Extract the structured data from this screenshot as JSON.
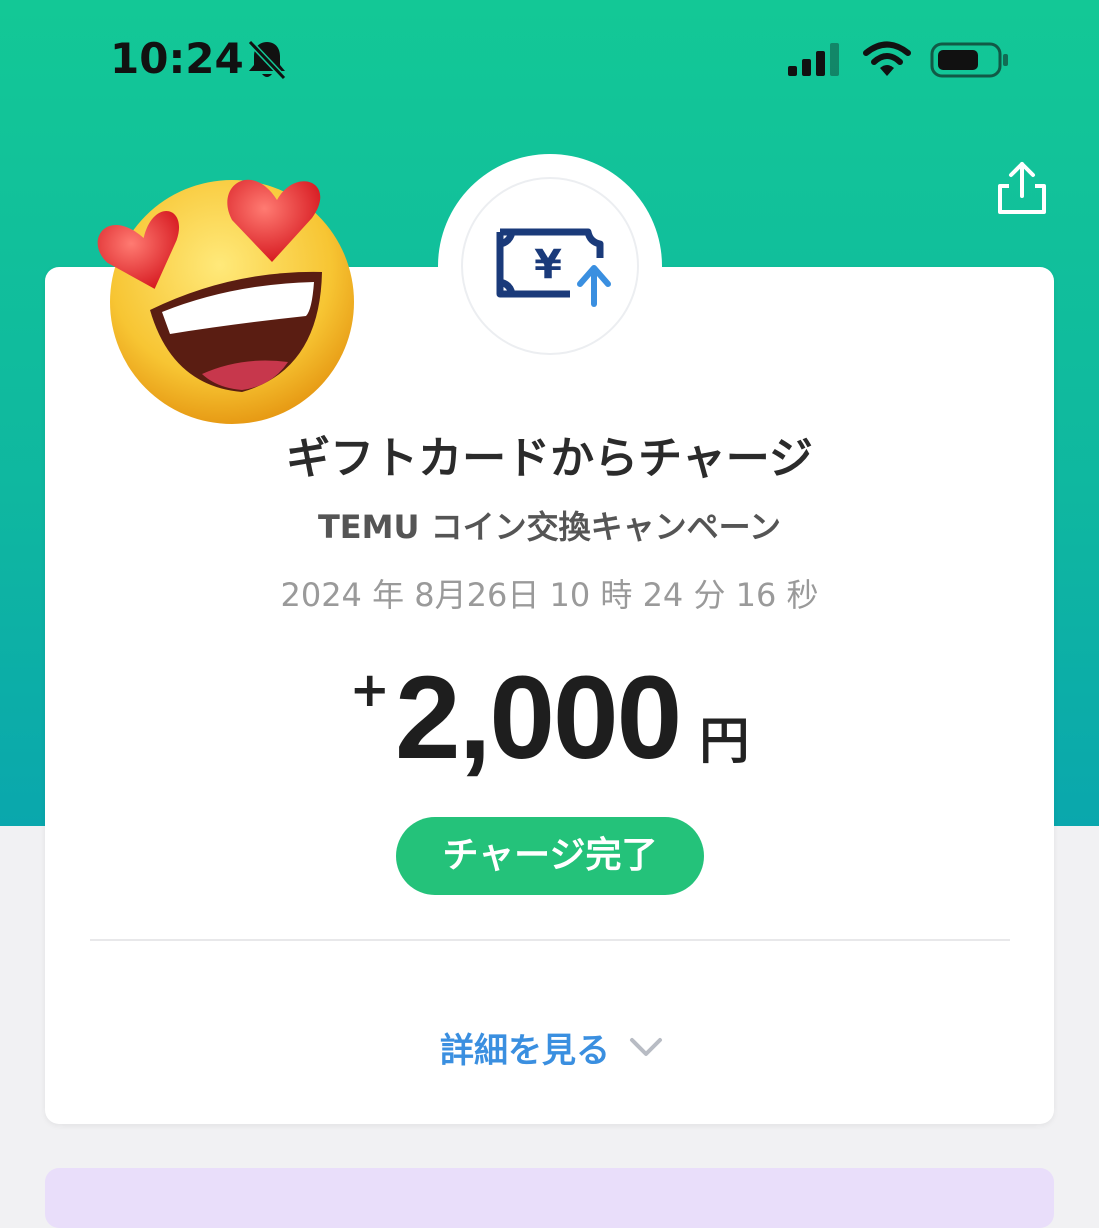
{
  "status_bar": {
    "time": "10:24"
  },
  "icons": {
    "share": "share-icon",
    "bell": "bell-slash-icon",
    "signal": "signal-icon",
    "wifi": "wifi-icon",
    "battery": "battery-icon",
    "main": "yen-charge-icon",
    "emoji": "heart-eyes-emoji",
    "chevron": "chevron-down-icon"
  },
  "transaction": {
    "title": "ギフトカードからチャージ",
    "subtitle": "TEMU コイン交換キャンペーン",
    "datetime": "2024 年 8月26日 10 時 24 分 16 秒",
    "amount_sign": "+",
    "amount": "2,000",
    "currency": "円",
    "status": "チャージ完了",
    "details_link": "詳細を見る"
  },
  "colors": {
    "header": "#13c896",
    "badge": "#24c27a",
    "link": "#3a8fe0",
    "icon_dark": "#1a3a7a",
    "icon_accent": "#3a8fe0"
  }
}
